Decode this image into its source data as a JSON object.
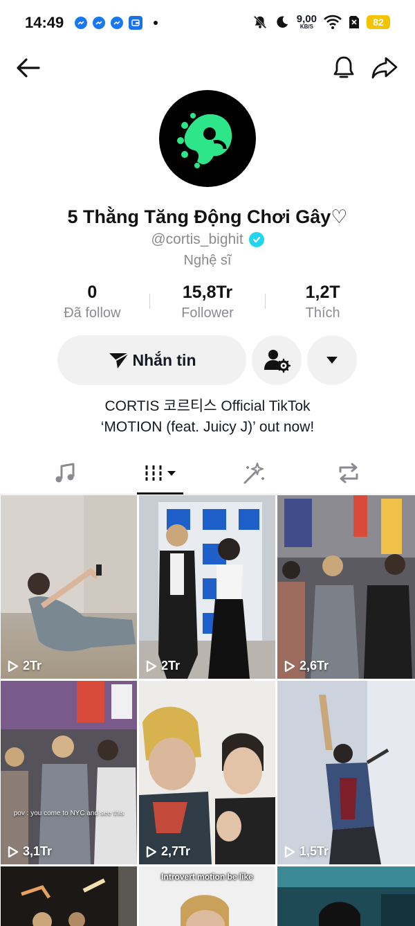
{
  "status_bar": {
    "time": "14:49",
    "speed_value": "9,00",
    "speed_unit": "KB/S",
    "battery": "82",
    "battery_color": "#f5c400"
  },
  "profile": {
    "display_name": "5 Thằng Tăng Động Chơi Gây♡",
    "username": "@cortis_bighit",
    "category": "Nghệ sĩ",
    "avatar_color": "#000000",
    "avatar_accent": "#2ee68a"
  },
  "stats": [
    {
      "value": "0",
      "label": "Đã follow"
    },
    {
      "value": "15,8Tr",
      "label": "Follower"
    },
    {
      "value": "1,2T",
      "label": "Thích"
    }
  ],
  "actions": {
    "message_label": "Nhắn tin"
  },
  "bio": {
    "line1": "CORTIS 코르티스 Official TikTok",
    "line2": "‘MOTION (feat. Juicy J)’ out now!"
  },
  "tabs": [
    {
      "icon": "music-note-icon"
    },
    {
      "icon": "grid-sort-icon",
      "active": true
    },
    {
      "icon": "sparkle-wand-icon"
    },
    {
      "icon": "repost-icon"
    }
  ],
  "videos": [
    {
      "views": "2Tr"
    },
    {
      "views": "2Tr"
    },
    {
      "views": "2,6Tr"
    },
    {
      "views": "3,1Tr",
      "caption": "pov : you come to NYC and see this"
    },
    {
      "views": "2,7Tr"
    },
    {
      "views": "1,5Tr"
    },
    {
      "views": ""
    },
    {
      "views": "",
      "caption": "Introvert motion be like"
    },
    {
      "views": ""
    }
  ]
}
